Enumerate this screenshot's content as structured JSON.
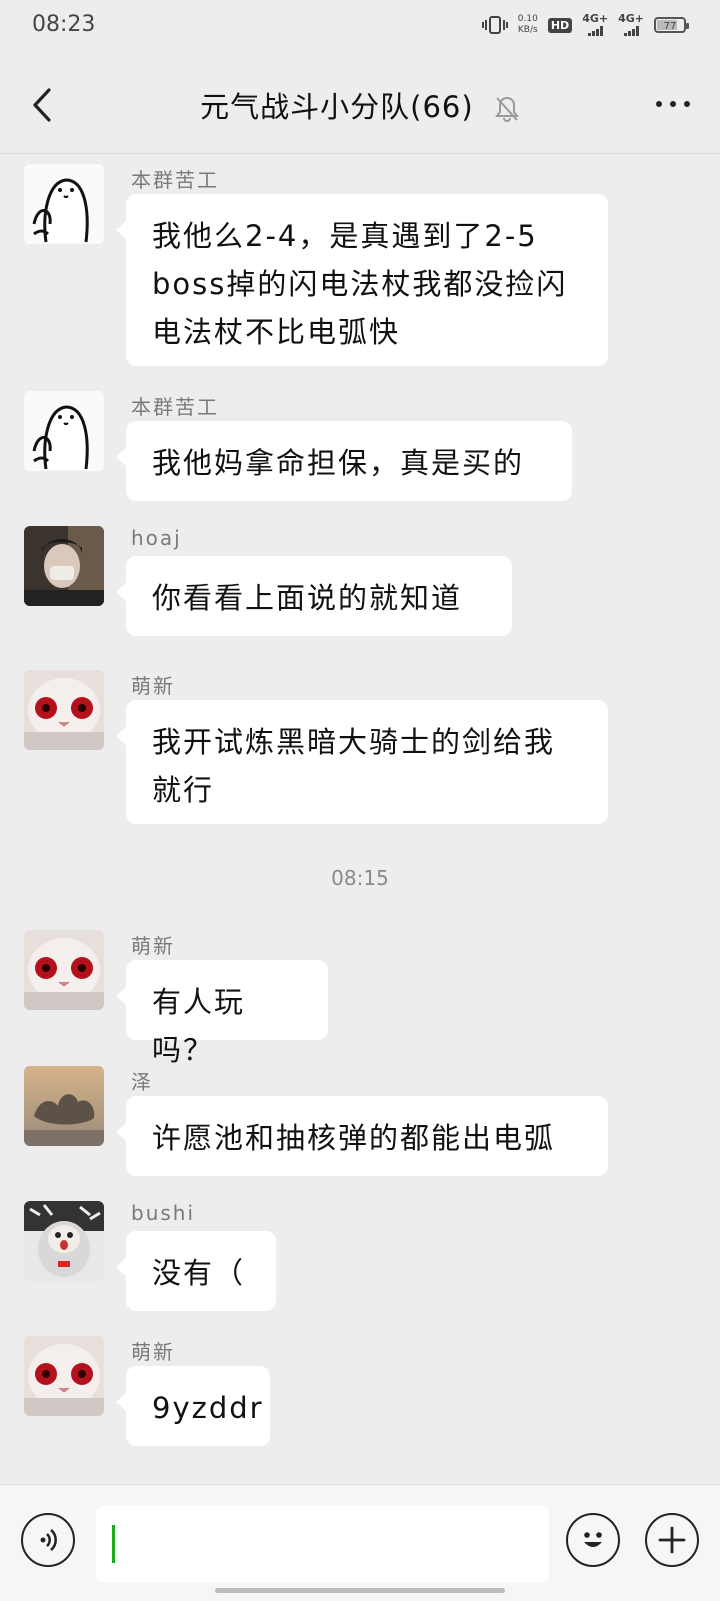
{
  "status_bar": {
    "time": "08:23",
    "net_speed_value": "0.10",
    "net_speed_unit": "KB/s",
    "hd_label": "HD",
    "signal_1": "4G+",
    "signal_2": "4G+",
    "battery": "77",
    "battery_level_percent": 77
  },
  "header": {
    "title": "元气战斗小分队(66)",
    "back_icon": "chevron-left-icon",
    "mute_icon": "bell-muted-icon",
    "more_icon": "more-dots-icon"
  },
  "messages": [
    {
      "sender": "本群苦工",
      "avatar": "cartoon-blob-avatar",
      "text": "我他么2-4，是真遇到了2-5 boss掉的闪电法杖我都没捡闪电法杖不比电弧快"
    },
    {
      "sender": "本群苦工",
      "avatar": "cartoon-blob-avatar",
      "text": "我他妈拿命担保，真是买的"
    },
    {
      "sender": "hoaj",
      "avatar": "person-photo-avatar",
      "text": "你看看上面说的就知道"
    },
    {
      "sender": "萌新",
      "avatar": "red-eye-cat-avatar",
      "text": "我开试炼黑暗大骑士的剑给我就行"
    },
    {
      "sender": "萌新",
      "avatar": "red-eye-cat-avatar",
      "text": "有人玩吗？"
    },
    {
      "sender": "泽",
      "avatar": "sky-cloud-avatar",
      "text": "许愿池和抽核弹的都能出电弧"
    },
    {
      "sender": "bushi",
      "avatar": "cat-hoodie-avatar",
      "text": "没有（"
    },
    {
      "sender": "萌新",
      "avatar": "red-eye-cat-avatar",
      "text": "9yzddr"
    }
  ],
  "timestamp": "08:15",
  "input_bar": {
    "voice_icon": "voice-icon",
    "emoji_icon": "emoji-icon",
    "plus_icon": "plus-icon",
    "input_value": ""
  },
  "colors": {
    "background": "#ededed",
    "bubble": "#ffffff",
    "caret": "#1aad19",
    "sender_text": "#7a7a7a"
  }
}
